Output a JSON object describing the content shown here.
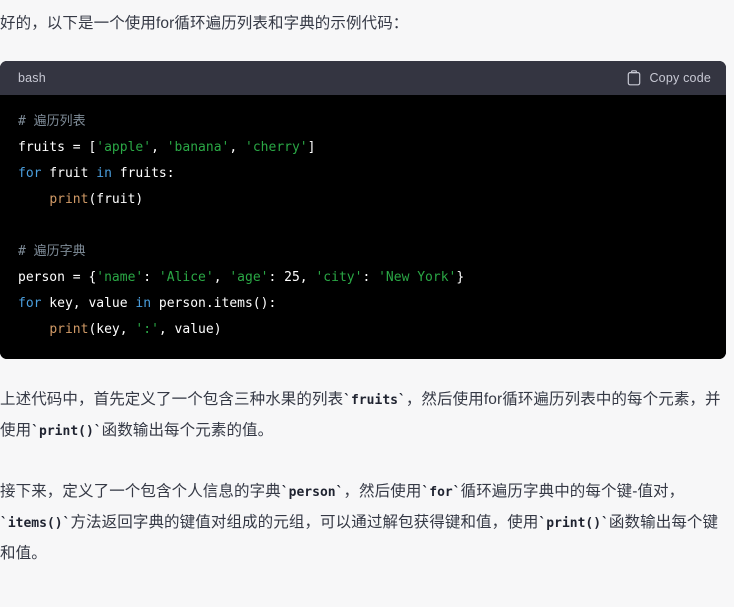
{
  "theme": {
    "page_bg": "#f7f7f8",
    "text_color": "#353945",
    "code_header_bg": "#343541",
    "code_body_bg": "#000000",
    "code_label_color": "#c8c9d4",
    "token_comment": "#7f8c98",
    "token_keyword": "#4a9edd",
    "token_string": "#2aa745",
    "token_function": "#d19a66",
    "token_plain": "#ffffff"
  },
  "message": {
    "intro": "好的，以下是一个使用for循环遍历列表和字典的示例代码：",
    "paragraphs": [
      {
        "segments": [
          {
            "type": "text",
            "value": "上述代码中，首先定义了一个包含三种水果的列表"
          },
          {
            "type": "code",
            "value": "`fruits`"
          },
          {
            "type": "text",
            "value": "，然后使用for循环遍历列表中的每个元素，并使用"
          },
          {
            "type": "code",
            "value": "`print()`"
          },
          {
            "type": "text",
            "value": "函数输出每个元素的值。"
          }
        ]
      },
      {
        "segments": [
          {
            "type": "text",
            "value": "接下来，定义了一个包含个人信息的字典"
          },
          {
            "type": "code",
            "value": "`person`"
          },
          {
            "type": "text",
            "value": "，然后使用"
          },
          {
            "type": "code",
            "value": "`for`"
          },
          {
            "type": "text",
            "value": "循环遍历字典中的每个键-值对，"
          },
          {
            "type": "code",
            "value": "`items()`"
          },
          {
            "type": "text",
            "value": "方法返回字典的键值对组成的元组，可以通过解包获得键和值，使用"
          },
          {
            "type": "code",
            "value": "`print()`"
          },
          {
            "type": "text",
            "value": "函数输出每个键和值。"
          }
        ]
      }
    ]
  },
  "code_block": {
    "language_label": "bash",
    "copy_label": "Copy code",
    "copy_icon": "clipboard-icon",
    "lines": [
      [
        {
          "t": "comment",
          "v": "# 遍历列表"
        }
      ],
      [
        {
          "t": "plain",
          "v": "fruits = ["
        },
        {
          "t": "string",
          "v": "'apple'"
        },
        {
          "t": "plain",
          "v": ", "
        },
        {
          "t": "string",
          "v": "'banana'"
        },
        {
          "t": "plain",
          "v": ", "
        },
        {
          "t": "string",
          "v": "'cherry'"
        },
        {
          "t": "plain",
          "v": "]"
        }
      ],
      [
        {
          "t": "keyword",
          "v": "for"
        },
        {
          "t": "plain",
          "v": " fruit "
        },
        {
          "t": "keyword",
          "v": "in"
        },
        {
          "t": "plain",
          "v": " fruits:"
        }
      ],
      [
        {
          "t": "plain",
          "v": "    "
        },
        {
          "t": "func",
          "v": "print"
        },
        {
          "t": "plain",
          "v": "(fruit)"
        }
      ],
      [
        {
          "t": "plain",
          "v": ""
        }
      ],
      [
        {
          "t": "comment",
          "v": "# 遍历字典"
        }
      ],
      [
        {
          "t": "plain",
          "v": "person = {"
        },
        {
          "t": "string",
          "v": "'name'"
        },
        {
          "t": "plain",
          "v": ": "
        },
        {
          "t": "string",
          "v": "'Alice'"
        },
        {
          "t": "plain",
          "v": ", "
        },
        {
          "t": "string",
          "v": "'age'"
        },
        {
          "t": "plain",
          "v": ": 25, "
        },
        {
          "t": "string",
          "v": "'city'"
        },
        {
          "t": "plain",
          "v": ": "
        },
        {
          "t": "string",
          "v": "'New York'"
        },
        {
          "t": "plain",
          "v": "}"
        }
      ],
      [
        {
          "t": "keyword",
          "v": "for"
        },
        {
          "t": "plain",
          "v": " key, value "
        },
        {
          "t": "keyword",
          "v": "in"
        },
        {
          "t": "plain",
          "v": " person.items():"
        }
      ],
      [
        {
          "t": "plain",
          "v": "    "
        },
        {
          "t": "func",
          "v": "print"
        },
        {
          "t": "plain",
          "v": "(key, "
        },
        {
          "t": "string",
          "v": "':'"
        },
        {
          "t": "plain",
          "v": ", value)"
        }
      ]
    ]
  }
}
